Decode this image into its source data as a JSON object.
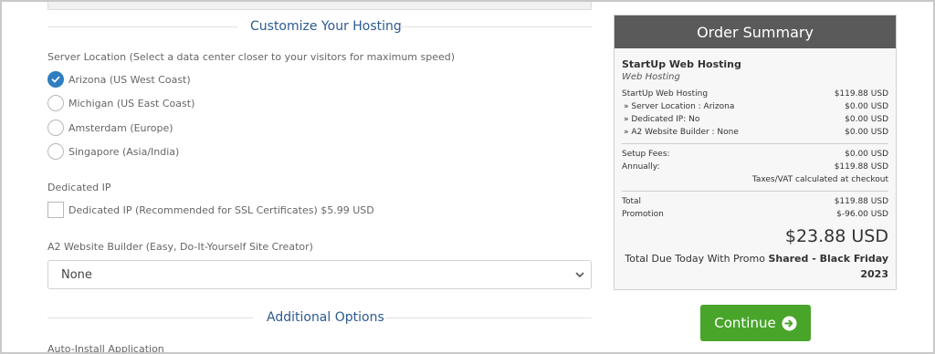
{
  "customize": {
    "title": "Customize Your Hosting"
  },
  "server_location": {
    "label": "Server Location (Select a data center closer to your visitors for maximum speed)",
    "options": [
      {
        "label": "Arizona (US West Coast)",
        "checked": true
      },
      {
        "label": "Michigan (US East Coast)",
        "checked": false
      },
      {
        "label": "Amsterdam (Europe)",
        "checked": false
      },
      {
        "label": "Singapore (Asia/India)",
        "checked": false
      }
    ]
  },
  "dedicated_ip": {
    "label": "Dedicated IP",
    "checkbox_label": "Dedicated IP (Recommended for SSL Certificates) $5.99 USD"
  },
  "website_builder": {
    "label": "A2 Website Builder (Easy, Do-It-Yourself Site Creator)",
    "selected": "None"
  },
  "additional": {
    "title": "Additional Options"
  },
  "auto_install": {
    "label": "Auto-Install Application"
  },
  "summary": {
    "title": "Order Summary",
    "product": "StartUp Web Hosting",
    "group": "Web Hosting",
    "lines": [
      {
        "label": "StartUp Web Hosting",
        "value": "$119.88 USD"
      },
      {
        "label": "» Server Location : Arizona",
        "value": "$0.00 USD"
      },
      {
        "label": "» Dedicated IP: No",
        "value": "$0.00 USD"
      },
      {
        "label": "» A2 Website Builder : None",
        "value": "$0.00 USD"
      }
    ],
    "setup_label": "Setup Fees:",
    "setup_value": "$0.00 USD",
    "annually_label": "Annually:",
    "annually_value": "$119.88 USD",
    "tax_note": "Taxes/VAT calculated at checkout",
    "total_label": "Total",
    "total_value": "$119.88 USD",
    "promo_label": "Promotion",
    "promo_value": "$-96.00 USD",
    "due_amount": "$23.88 USD",
    "due_text": "Total Due Today With Promo",
    "promo_name": "Shared - Black Friday 2023"
  },
  "continue_label": "Continue",
  "colors": {
    "accent": "#2f7ec0",
    "continue": "#48a52a",
    "summary_header": "#5a5a5a",
    "title": "#2c5a8f"
  },
  "icons": {
    "radio_checked": "check-icon",
    "select": "chevron-down-icon",
    "continue": "arrow-right-circle-icon"
  }
}
